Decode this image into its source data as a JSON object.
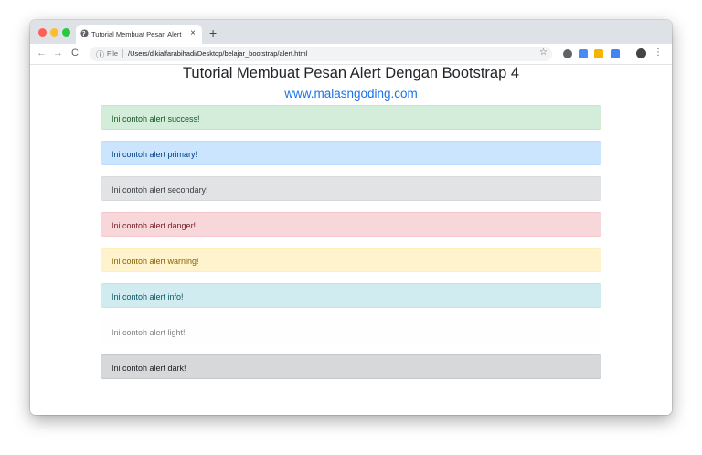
{
  "browser": {
    "tab_title": "Tutorial Membuat Pesan Alert D",
    "tab_close": "×",
    "new_tab": "+",
    "nav": {
      "back": "←",
      "forward": "→",
      "reload": "C"
    },
    "address": {
      "file_label": "File",
      "url": "/Users/dikialfarabihadi/Desktop/belajar_bootstrap/alert.html"
    },
    "star": "☆",
    "menu": "⋮"
  },
  "page": {
    "heading": "Tutorial Membuat Pesan Alert Dengan Bootstrap 4",
    "link": "www.malasngoding.com"
  },
  "alerts": [
    {
      "text": "Ini contoh alert success!",
      "bg": "#d4edda",
      "border": "#c3e6cb",
      "color": "#155724"
    },
    {
      "text": "Ini contoh alert primary!",
      "bg": "#cce5ff",
      "border": "#b8daff",
      "color": "#004085"
    },
    {
      "text": "Ini contoh alert secondary!",
      "bg": "#e2e3e5",
      "border": "#d6d8db",
      "color": "#383d41"
    },
    {
      "text": "Ini contoh alert danger!",
      "bg": "#f8d7da",
      "border": "#f5c6cb",
      "color": "#721c24"
    },
    {
      "text": "Ini contoh alert warning!",
      "bg": "#fff3cd",
      "border": "#ffeeba",
      "color": "#856404"
    },
    {
      "text": "Ini contoh alert info!",
      "bg": "#d1ecf1",
      "border": "#bee5eb",
      "color": "#0c5460"
    },
    {
      "text": "Ini contoh alert light!",
      "bg": "#fefefe",
      "border": "#fdfdfe",
      "color": "#818182"
    },
    {
      "text": "Ini contoh alert dark!",
      "bg": "#d6d8d9",
      "border": "#c6c8ca",
      "color": "#1b1e21"
    }
  ]
}
